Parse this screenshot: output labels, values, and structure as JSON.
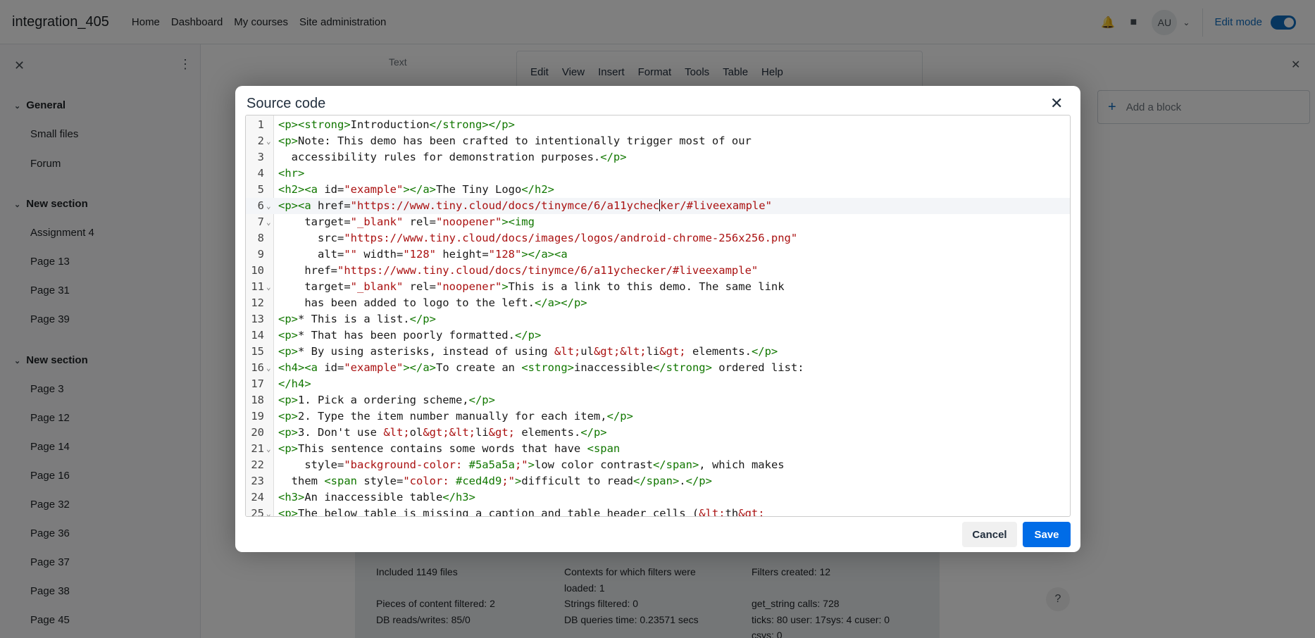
{
  "navbar": {
    "site_name": "integration_405",
    "links": [
      "Home",
      "Dashboard",
      "My courses",
      "Site administration"
    ],
    "avatar_initials": "AU",
    "edit_mode_label": "Edit mode"
  },
  "drawer": {
    "sections": [
      {
        "title": "General",
        "items": [
          "Small files",
          "Forum"
        ]
      },
      {
        "title": "New section",
        "items": [
          "Assignment 4",
          "Page 13",
          "Page 31",
          "Page 39"
        ]
      },
      {
        "title": "New section",
        "items": [
          "Page 3",
          "Page 12",
          "Page 14",
          "Page 16",
          "Page 32",
          "Page 36",
          "Page 37",
          "Page 38",
          "Page 45"
        ]
      }
    ]
  },
  "editor": {
    "field_label": "Text",
    "menu": [
      "Edit",
      "View",
      "Insert",
      "Format",
      "Tools",
      "Table",
      "Help"
    ]
  },
  "blocks": {
    "add_block": "Add a block"
  },
  "perf": {
    "col1": [
      "Included 1149 files",
      "Pieces of content filtered: 2",
      "DB reads/writes: 85/0"
    ],
    "col2": [
      "Contexts for which filters were",
      "loaded: 1",
      "Strings filtered: 0",
      "DB queries time: 0.23571 secs"
    ],
    "col3": [
      "Filters created: 12",
      "get_string calls: 728",
      "ticks: 80 user: 17sys: 4 cuser: 0",
      "csys: 0"
    ]
  },
  "help_label": "?",
  "dialog": {
    "title": "Source code",
    "cancel_label": "Cancel",
    "save_label": "Save",
    "lines": [
      "1",
      "2",
      "3",
      "4",
      "5",
      "6",
      "7",
      "8",
      "9",
      "10",
      "11",
      "12",
      "13",
      "14",
      "15",
      "16",
      "17",
      "18",
      "19",
      "20",
      "21",
      "22",
      "23",
      "24",
      "25"
    ]
  },
  "colors": {
    "primary": "#0f6cbf",
    "save_button": "#006ce7",
    "tag": "#117700",
    "string": "#aa1111"
  }
}
